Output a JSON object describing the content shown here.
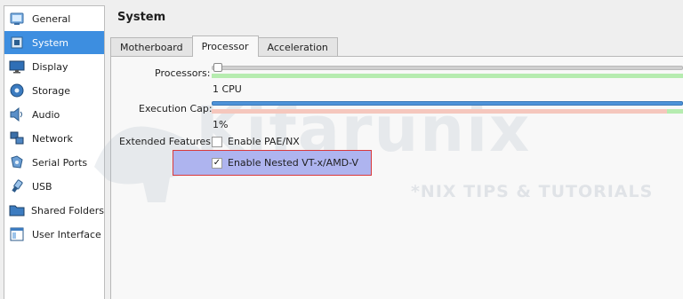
{
  "sidebar": {
    "items": [
      {
        "label": "General",
        "icon": "general-icon"
      },
      {
        "label": "System",
        "icon": "system-icon",
        "selected": true
      },
      {
        "label": "Display",
        "icon": "display-icon"
      },
      {
        "label": "Storage",
        "icon": "storage-icon"
      },
      {
        "label": "Audio",
        "icon": "audio-icon"
      },
      {
        "label": "Network",
        "icon": "network-icon"
      },
      {
        "label": "Serial Ports",
        "icon": "serial-ports-icon"
      },
      {
        "label": "USB",
        "icon": "usb-icon"
      },
      {
        "label": "Shared Folders",
        "icon": "shared-folders-icon"
      },
      {
        "label": "User Interface",
        "icon": "user-interface-icon"
      }
    ],
    "selected_color": "#3d8ee0"
  },
  "header": {
    "title": "System"
  },
  "tabs": [
    {
      "label": "Motherboard",
      "active": false
    },
    {
      "label": "Processor",
      "active": true
    },
    {
      "label": "Acceleration",
      "active": false
    }
  ],
  "processor": {
    "processors_label": "Processors:",
    "processors_value": "1 CPU",
    "exec_cap_label": "Execution Cap:",
    "exec_cap_value": "1%",
    "extended_features_label": "Extended Features:",
    "enable_pae_label": "Enable PAE/NX",
    "enable_pae_checked": false,
    "enable_nested_label": "Enable Nested VT-x/AMD-V",
    "enable_nested_checked": true,
    "check_mark": "✓"
  },
  "watermark": {
    "text": "Kifarunix",
    "subtitle": "*NIX TIPS & TUTORIALS"
  },
  "colors": {
    "processors_scale_green": "#b6ecb0",
    "exec_scale_red": "#f5c7bd",
    "exec_groove_blue": "#4d93d9",
    "highlight_bg": "#aeb4ef",
    "highlight_border": "#d9393b"
  }
}
